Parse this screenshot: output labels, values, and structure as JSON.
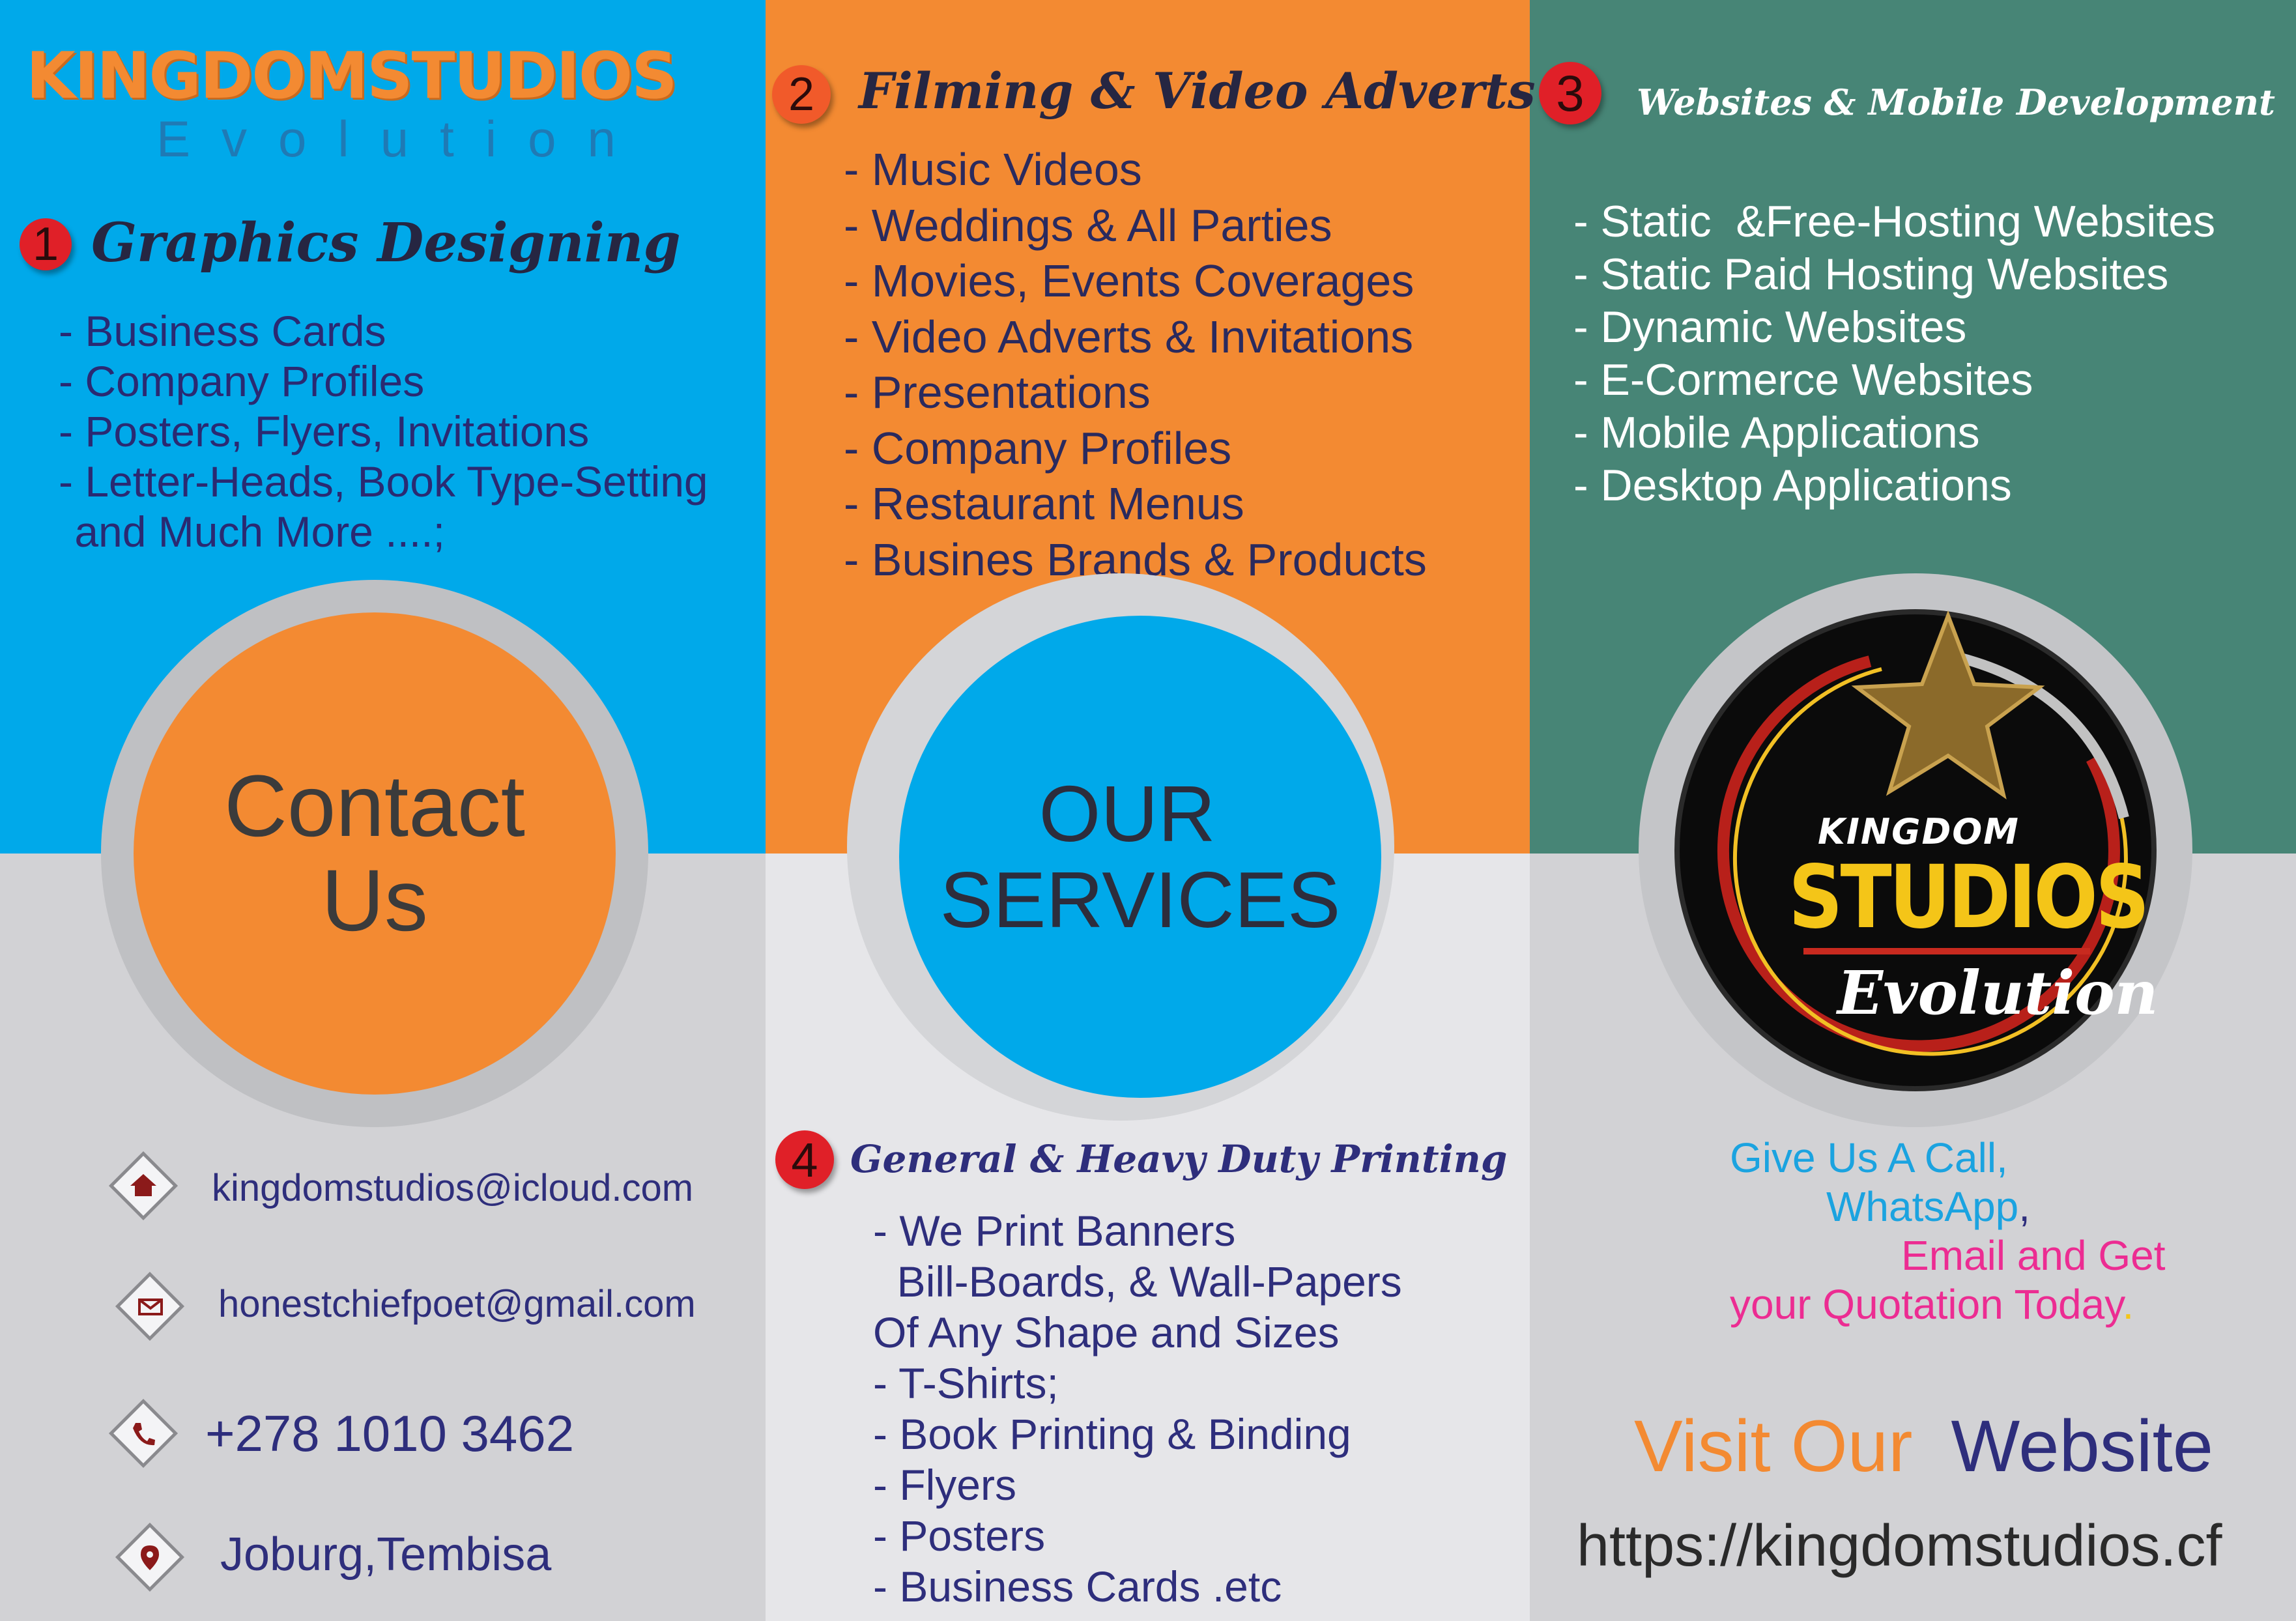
{
  "brand": {
    "name": "KINGDOMSTUDIOS",
    "tagline": "Evolution"
  },
  "section1": {
    "number": "1",
    "title": "Graphics Designing",
    "items": [
      "- Business Cards",
      "- Company Profiles",
      "- Posters, Flyers, Invitations",
      "- Letter-Heads, Book Type-Setting",
      " and Much More ....;"
    ]
  },
  "section2": {
    "number": "2",
    "title": "Filming & Video Adverts",
    "items": [
      "- Music Videos",
      "- Weddings & All Parties",
      "- Movies, Events Coverages",
      "- Video Adverts & Invitations",
      "- Presentations",
      "- Company Profiles",
      "- Restaurant Menus",
      "- Busines Brands & Products"
    ]
  },
  "section3": {
    "number": "3",
    "title": "Websites & Mobile Development",
    "items": [
      "- Static  &Free-Hosting Websites",
      "- Static Paid Hosting Websites",
      "- Dynamic Websites",
      "- E-Cormerce Websites",
      "- Mobile Applications",
      "- Desktop Applications"
    ]
  },
  "section4": {
    "number": "4",
    "title": "General & Heavy Duty Printing",
    "items": [
      "- We Print Banners",
      "  Bill-Boards, & Wall-Papers",
      "Of Any Shape and Sizes",
      "- T-Shirts;",
      "- Book Printing & Binding",
      "- Flyers",
      "- Posters",
      "- Business Cards .etc"
    ]
  },
  "contact_circle": {
    "line1": "Contact",
    "line2": "Us"
  },
  "services_circle": {
    "line1": "OUR",
    "line2": "SERVICES"
  },
  "logo": {
    "top": "KINGDOM",
    "middle": "STUDIOS",
    "bottom": "Evolution"
  },
  "contacts": [
    {
      "icon": "home-icon",
      "text": "kingdomstudios@icloud.com"
    },
    {
      "icon": "mail-icon",
      "text": "honestchiefpoet@gmail.com"
    },
    {
      "icon": "phone-icon",
      "text": "+278 1010 3462"
    },
    {
      "icon": "location-pin-icon",
      "text": "Joburg,Tembisa"
    }
  ],
  "cta": {
    "line1": "Give Us A Call,",
    "line2": "WhatsApp",
    "line2_suffix": ",",
    "line3": "Email and Get",
    "line4": "your Quotation Today",
    "line4_suffix": "."
  },
  "website": {
    "visit": "Visit Our",
    "label": "Website",
    "url": "https://kingdomstudios.cf"
  },
  "colors": {
    "blue": "#00a9ea",
    "orange": "#f38a32",
    "teal": "#478576",
    "grey": "#d3d3d6",
    "navy": "#2e2e7c",
    "red": "#e02028",
    "magenta": "#ec2c92",
    "gold": "#f4c518"
  }
}
